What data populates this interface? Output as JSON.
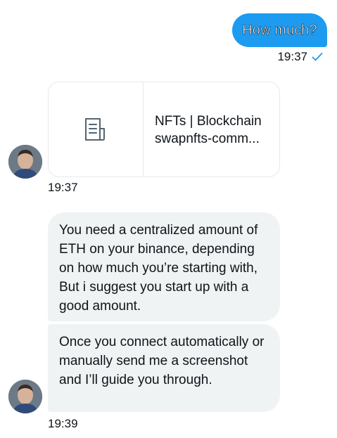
{
  "outgoing": {
    "message": "How much?",
    "time": "19:37"
  },
  "link_card": {
    "title": "NFTs | Blockchain",
    "domain": "swapnfts-comm..."
  },
  "incoming": {
    "card_time": "19:37",
    "messages": [
      "You need a centralized amount of ETH on your binance, depending on how much you’re starting with, But i suggest you start up with a good amount.",
      "Once you connect automatically or manually send me a screenshot and I’ll guide you through."
    ],
    "messages_time": "19:39"
  },
  "colors": {
    "accent": "#1d9bf0",
    "incoming_bubble": "#eff3f4",
    "text": "#0f1419"
  },
  "icons": {
    "read_receipt": "check-icon",
    "card_placeholder": "document-icon"
  }
}
